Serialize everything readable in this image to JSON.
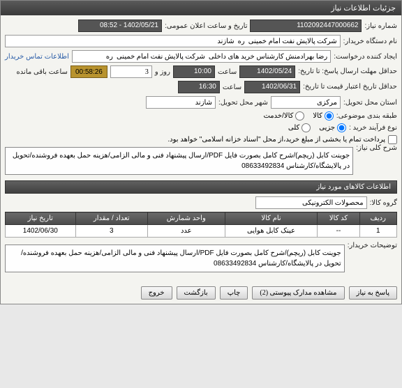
{
  "titlebar": "جزئیات اطلاعات نیاز",
  "fields": {
    "need_number_label": "شماره نیاز:",
    "need_number": "1102092447000662",
    "announce_label": "تاریخ و ساعت اعلان عمومی:",
    "announce_value": "1402/05/21 - 08:52",
    "buyer_label": "نام دستگاه خریدار:",
    "buyer_value": "شرکت پالایش نفت امام خمینی  ره  شازند",
    "creator_label": "ایجاد کننده درخواست:",
    "creator_value": "رضا بهرادمنش کارشناس خرید های داخلی  شرکت پالایش نفت امام خمینی  ره",
    "contact_link": "اطلاعات تماس خریدار",
    "deadline_label": "حداقل\nمهلت ارسال پاسخ: تا\nتاریخ:",
    "deadline_date": "1402/05/24",
    "time_label": "ساعت",
    "deadline_time": "10:00",
    "day_label": "روز و",
    "days": "3",
    "countdown": "00:58:26",
    "remaining": "ساعت باقی مانده",
    "validity_label": "حداقل تاریخ اعتبار\nقیمت تا تاریخ:",
    "validity_date": "1402/06/31",
    "validity_time": "16:30",
    "delivery_state_label": "استان محل تحویل:",
    "delivery_state": "مرکزی",
    "delivery_city_label": "شهر محل تحویل:",
    "delivery_city": "شازند",
    "packing_label": "طبقه بندی موضوعی:",
    "process_label": "نوع فرآیند خرید :",
    "partial": "جزیی",
    "full": "کلی",
    "goods": "کالا",
    "service": "کالا/خدمت",
    "treasury_note": "پرداخت تمام یا بخشی از مبلغ خرید،از محل \"اسناد خزانه اسلامی\" خواهد بود.",
    "subject_label": "شرح کلی نیاز:",
    "subject_text": "جوینت کابل (ریچم)/شرح کامل بصورت فایل PDF/ارسال پیشنهاد فنی و مالی الزامی/هزینه حمل بعهده فروشنده/تحویل در پالایشگاه/کارشناس 08633492834",
    "items_header": "اطلاعات کالاهای مورد نیاز",
    "group_label": "گروه کالا:",
    "group_value": "محصولات الکترونیکی",
    "buyer_notes_label": "توضیحات خریدار:",
    "buyer_notes_text": "جوینت کابل (ریچم)/شرح کامل بصورت فایل PDF/ارسال پیشنهاد فنی و مالی الزامی/هزینه حمل بعهده فروشنده/تحویل در پالایشگاه/کارشناس 08633492834"
  },
  "table": {
    "headers": [
      "ردیف",
      "کد کالا",
      "نام کالا",
      "واحد شمارش",
      "تعداد / مقدار",
      "تاریخ نیاز"
    ],
    "rows": [
      {
        "idx": "1",
        "code": "--",
        "name": "عینک کابل هوایی",
        "unit": "عدد",
        "qty": "3",
        "date": "1402/06/30"
      }
    ]
  },
  "buttons": {
    "respond": "پاسخ به نیاز",
    "attachments": "مشاهده مدارک پیوستی (2)",
    "print": "چاپ",
    "back": "بازگشت",
    "exit": "خروج"
  }
}
